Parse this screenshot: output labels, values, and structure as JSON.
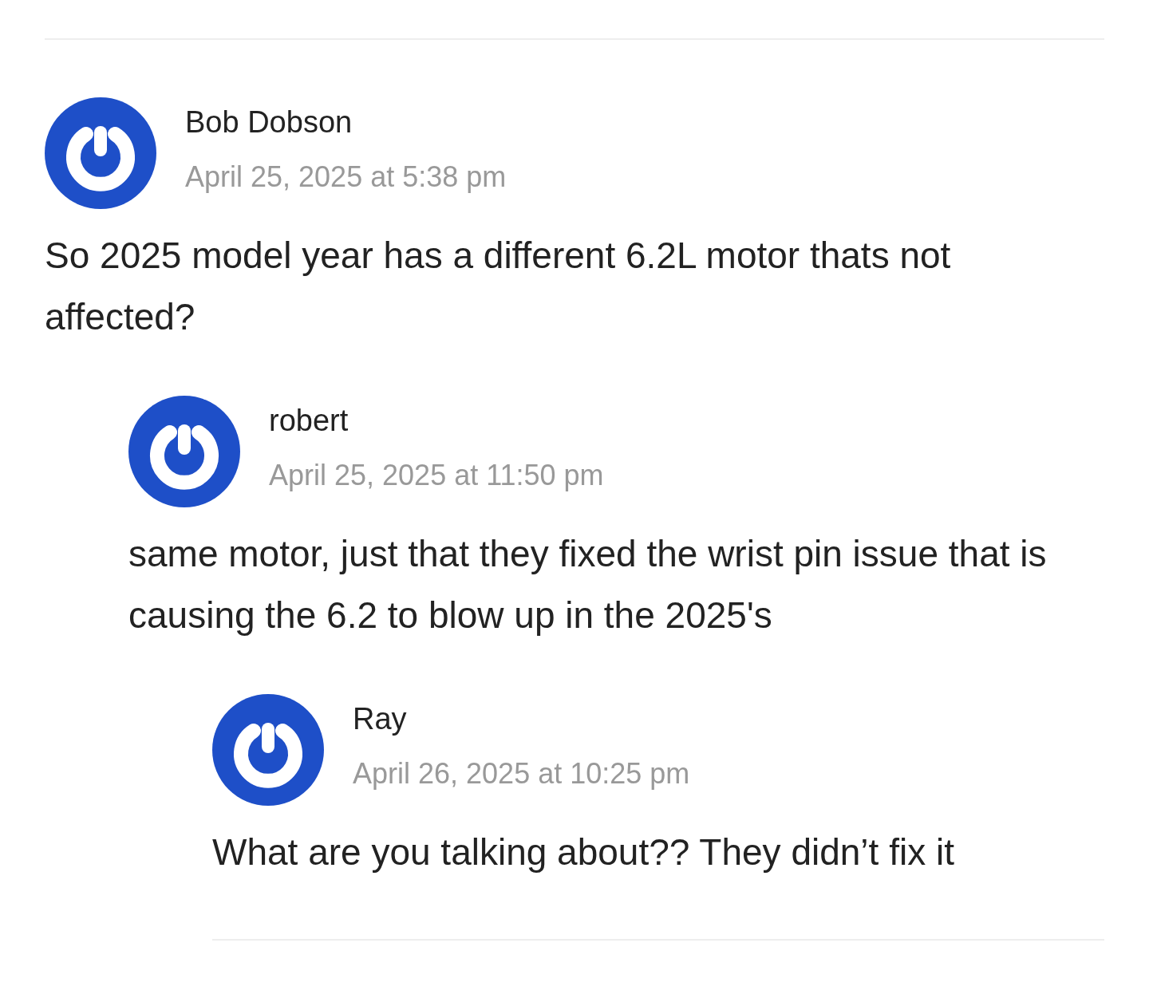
{
  "comments": [
    {
      "author": "Bob Dobson",
      "date": "April 25, 2025 at 5:38 pm",
      "text": "So 2025 model year has a different 6.2L motor thats not affected?",
      "children": [
        {
          "author": "robert",
          "date": "April 25, 2025 at 11:50 pm",
          "text": "same motor, just that they fixed the wrist pin issue that is causing the 6.2 to blow up in the 2025's",
          "children": [
            {
              "author": "Ray",
              "date": "April 26, 2025 at 10:25 pm",
              "text": "What are you talking about?? They didn’t fix it"
            }
          ]
        }
      ]
    }
  ]
}
